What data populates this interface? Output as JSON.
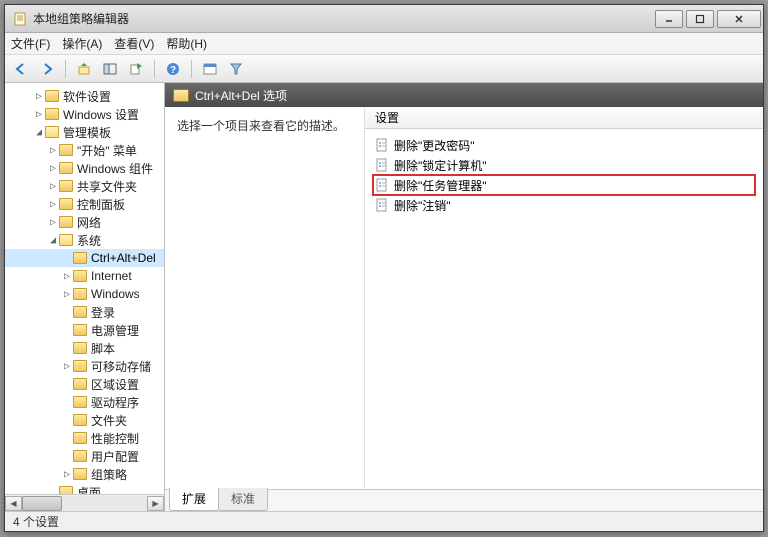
{
  "window": {
    "title": "本地组策略编辑器"
  },
  "menu": {
    "file": "文件(F)",
    "action": "操作(A)",
    "view": "查看(V)",
    "help": "帮助(H)"
  },
  "tree": [
    {
      "indent": 2,
      "exp": "▷",
      "label": "软件设置"
    },
    {
      "indent": 2,
      "exp": "▷",
      "label": "Windows 设置"
    },
    {
      "indent": 2,
      "exp": "◢",
      "label": "管理模板",
      "open": true
    },
    {
      "indent": 3,
      "exp": "▷",
      "label": "\"开始\" 菜单"
    },
    {
      "indent": 3,
      "exp": "▷",
      "label": "Windows 组件"
    },
    {
      "indent": 3,
      "exp": "▷",
      "label": "共享文件夹"
    },
    {
      "indent": 3,
      "exp": "▷",
      "label": "控制面板"
    },
    {
      "indent": 3,
      "exp": "▷",
      "label": "网络"
    },
    {
      "indent": 3,
      "exp": "◢",
      "label": "系统",
      "open": true
    },
    {
      "indent": 4,
      "exp": "",
      "label": "Ctrl+Alt+Del",
      "sel": true
    },
    {
      "indent": 4,
      "exp": "▷",
      "label": "Internet"
    },
    {
      "indent": 4,
      "exp": "▷",
      "label": "Windows"
    },
    {
      "indent": 4,
      "exp": "",
      "label": "登录"
    },
    {
      "indent": 4,
      "exp": "",
      "label": "电源管理"
    },
    {
      "indent": 4,
      "exp": "",
      "label": "脚本"
    },
    {
      "indent": 4,
      "exp": "▷",
      "label": "可移动存储"
    },
    {
      "indent": 4,
      "exp": "",
      "label": "区域设置"
    },
    {
      "indent": 4,
      "exp": "",
      "label": "驱动程序"
    },
    {
      "indent": 4,
      "exp": "",
      "label": "文件夹"
    },
    {
      "indent": 4,
      "exp": "",
      "label": "性能控制"
    },
    {
      "indent": 4,
      "exp": "",
      "label": "用户配置"
    },
    {
      "indent": 4,
      "exp": "▷",
      "label": "组策略"
    },
    {
      "indent": 3,
      "exp": "",
      "label": "桌面"
    }
  ],
  "path": {
    "label": "Ctrl+Alt+Del 选项"
  },
  "desc": {
    "prompt": "选择一个项目来查看它的描述。"
  },
  "list": {
    "header": "设置",
    "items": [
      {
        "label": "删除\"更改密码\""
      },
      {
        "label": "删除\"锁定计算机\""
      },
      {
        "label": "删除\"任务管理器\"",
        "hl": true
      },
      {
        "label": "删除\"注销\""
      }
    ]
  },
  "tabs": {
    "ext": "扩展",
    "std": "标准"
  },
  "status": {
    "text": "4 个设置"
  }
}
